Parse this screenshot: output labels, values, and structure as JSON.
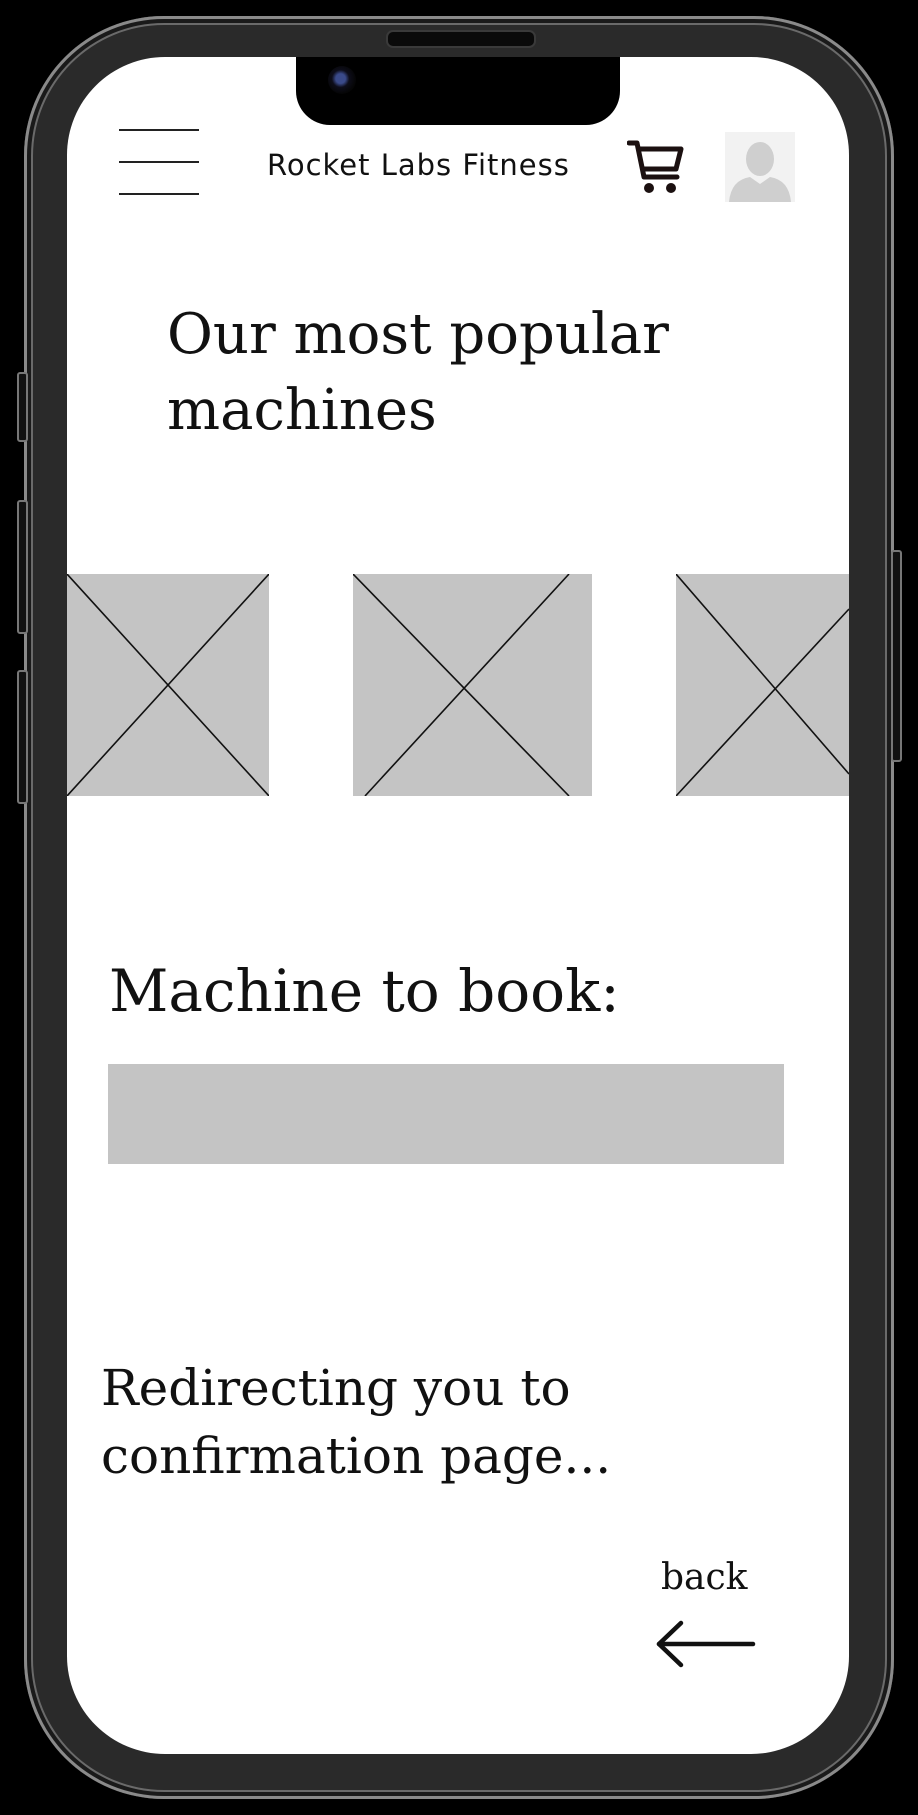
{
  "header": {
    "menu_icon": "hamburger-menu-icon",
    "brand": "Rocket Labs Fitness",
    "cart_icon": "shopping-cart-icon",
    "avatar_icon": "user-avatar-icon"
  },
  "popular": {
    "title": "Our most popular machines",
    "images": [
      "image-placeholder",
      "image-placeholder",
      "image-placeholder"
    ]
  },
  "booking": {
    "label": "Machine to book:",
    "value": "",
    "placeholder": ""
  },
  "status": {
    "message": "Redirecting you to confirmation page..."
  },
  "navigation": {
    "back_label": "back",
    "back_icon": "arrow-left-icon"
  },
  "colors": {
    "placeholder_fill": "#c4c4c4",
    "screen_background": "#ffffff",
    "device_frame": "#000000"
  }
}
